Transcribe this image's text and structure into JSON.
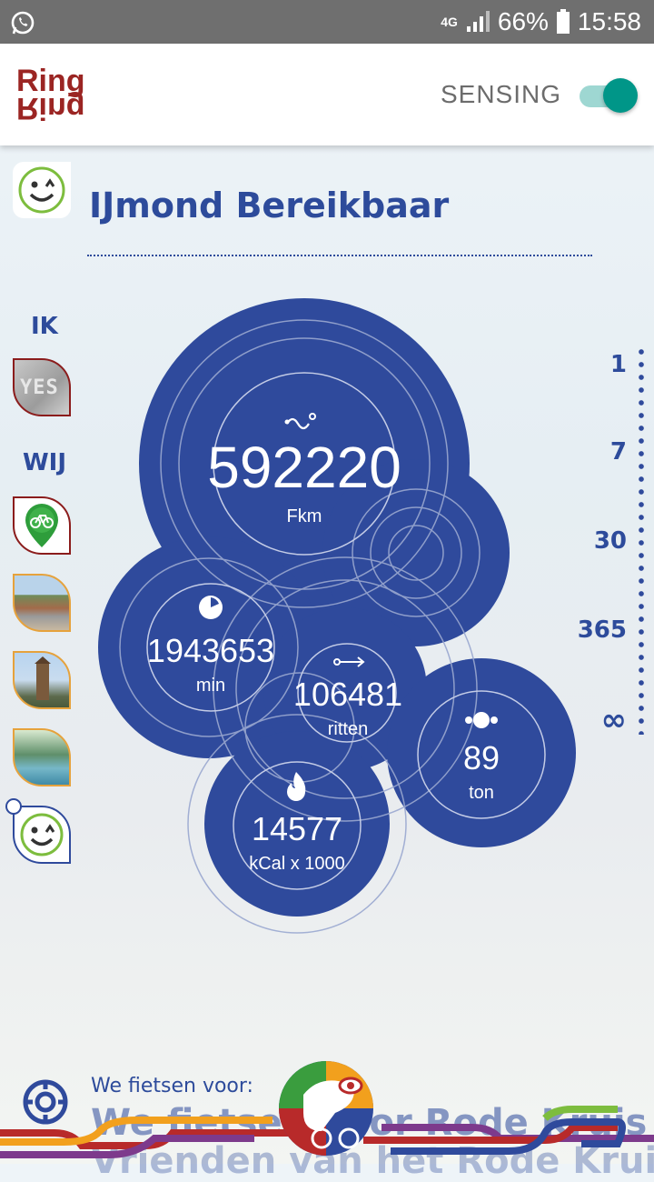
{
  "status_bar": {
    "network": "4G",
    "battery": "66%",
    "time": "15:58",
    "left_icon": "whatsapp-icon"
  },
  "app_bar": {
    "logo_top": "Ring",
    "logo_bottom": "Ring",
    "sensing_label": "SENSING",
    "sensing_on": true,
    "accent": "#009688"
  },
  "group": {
    "title": "IJmond Bereikbaar"
  },
  "sidebar": {
    "ik_label": "IK",
    "wij_label": "WIJ",
    "ik_thumb_text": "YES"
  },
  "stats": {
    "distance": {
      "value": "592220",
      "unit": "Fkm",
      "icon": "route-icon"
    },
    "time": {
      "value": "1943653",
      "unit": "min",
      "icon": "clock-icon"
    },
    "rides": {
      "value": "106481",
      "unit": "ritten",
      "icon": "arrow-right-icon"
    },
    "co2": {
      "value": "89",
      "unit": "ton",
      "icon": "cloud-icon"
    },
    "calories": {
      "value": "14577",
      "unit": "kCal x 1000",
      "icon": "flame-icon"
    }
  },
  "period_scale": [
    "1",
    "7",
    "30",
    "365",
    "∞"
  ],
  "footer": {
    "caption": "We fietsen voor:",
    "line1": "We fietsen voor Rode Kruis",
    "line2": "Vrienden van het Rode Kruis"
  },
  "colors": {
    "primary": "#2f4a9c",
    "title": "#2d4b9b"
  }
}
